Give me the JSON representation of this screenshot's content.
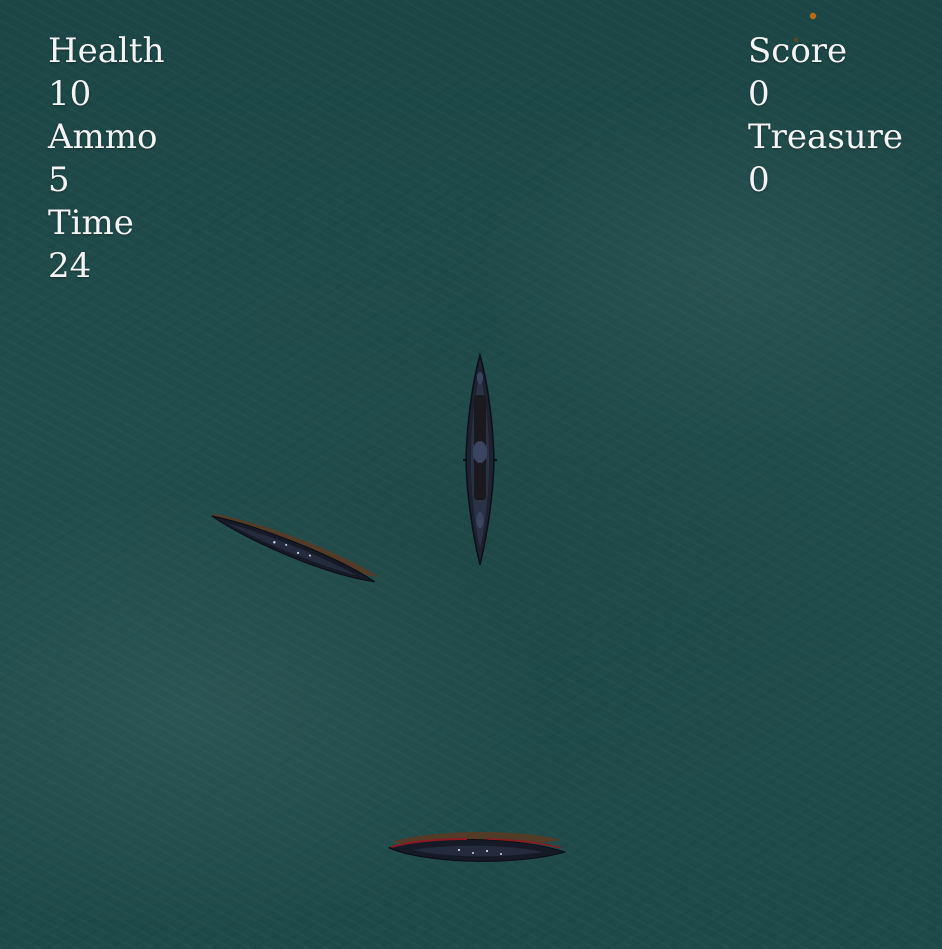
{
  "hud": {
    "left": {
      "health_label": "Health",
      "health_value": "10",
      "ammo_label": "Ammo",
      "ammo_value": "5",
      "time_label": "Time",
      "time_value": "24"
    },
    "right": {
      "score_label": "Score",
      "score_value": "0",
      "treasure_label": "Treasure",
      "treasure_value": "0"
    }
  },
  "colors": {
    "sea": "#1f4a4a",
    "hud_text": "#f4f4f4",
    "ship_hull": "#151a26",
    "ship_deck": "#2a3346",
    "ship_rust": "#5b3a22",
    "ship_accent_red": "#8a1a22",
    "debris_orange": "#b86a18"
  },
  "sprites": {
    "player_ship_icon": "player-ship-icon",
    "enemy_ship_icon": "enemy-ship-icon",
    "debris_icon": "debris-icon"
  }
}
